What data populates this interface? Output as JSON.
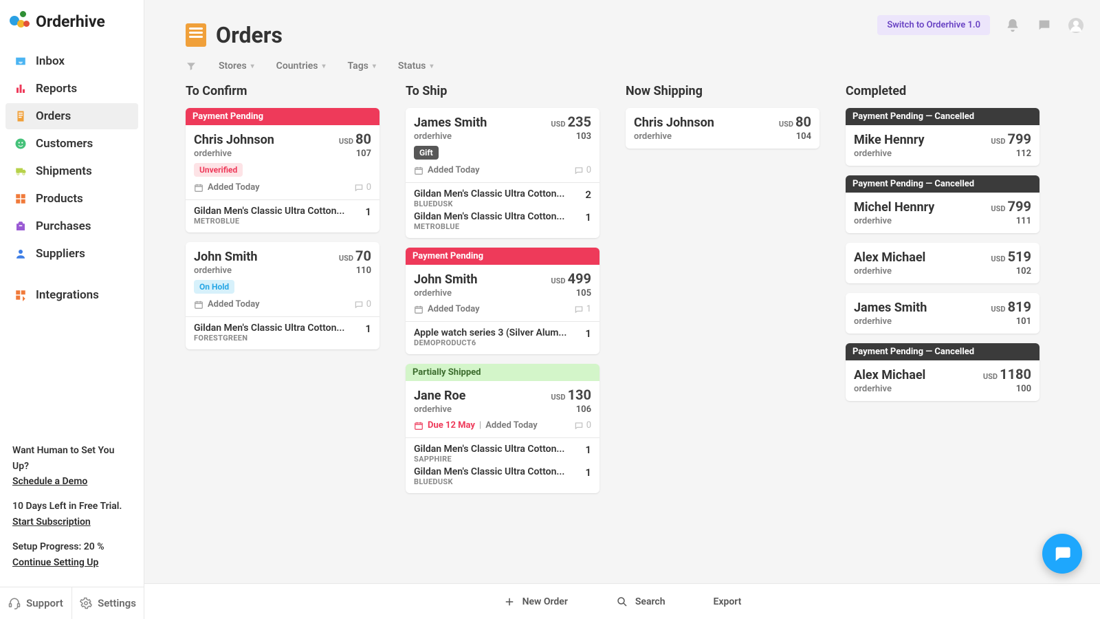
{
  "brand": "Orderhive",
  "topbar": {
    "switch_label": "Switch to Orderhive 1.0"
  },
  "sidebar": {
    "items": [
      {
        "label": "Inbox",
        "icon": "inbox-icon",
        "color": "#4bb4f2"
      },
      {
        "label": "Reports",
        "icon": "reports-icon",
        "color": "#ee3a5a"
      },
      {
        "label": "Orders",
        "icon": "orders-icon",
        "color": "#f0a03a",
        "active": true
      },
      {
        "label": "Customers",
        "icon": "customers-icon",
        "color": "#45c27a"
      },
      {
        "label": "Shipments",
        "icon": "shipments-icon",
        "color": "#b7d24a"
      },
      {
        "label": "Products",
        "icon": "products-icon",
        "color": "#f07a3a"
      },
      {
        "label": "Purchases",
        "icon": "purchases-icon",
        "color": "#9a5ad4"
      },
      {
        "label": "Suppliers",
        "icon": "suppliers-icon",
        "color": "#3d7ee6"
      }
    ],
    "integration_label": "Integrations",
    "promo": {
      "setup_q": "Want Human to Set You Up?",
      "demo_link": "Schedule a Demo",
      "trial_line": "10 Days Left in Free Trial.",
      "sub_link": "Start Subscription",
      "progress_line": "Setup Progress: 20 %",
      "continue_link": "Continue Setting Up"
    },
    "footer": {
      "support": "Support",
      "settings": "Settings"
    }
  },
  "page": {
    "title": "Orders"
  },
  "filters": [
    "Stores",
    "Countries",
    "Tags",
    "Status"
  ],
  "columns": [
    {
      "title": "To Confirm",
      "cards": [
        {
          "banner": "Payment Pending",
          "banner_class": "b-red",
          "customer": "Chris Johnson",
          "currency": "USD",
          "amount": "80",
          "store": "orderhive",
          "order_id": "107",
          "tag": "Unverified",
          "tag_class": "tag-unverified",
          "added": "Added Today",
          "comments": "0",
          "lines": [
            {
              "name": "Gildan Men's Classic Ultra Cotton...",
              "variant": "METROBLUE",
              "qty": "1"
            }
          ]
        },
        {
          "customer": "John Smith",
          "currency": "USD",
          "amount": "70",
          "store": "orderhive",
          "order_id": "110",
          "tag": "On Hold",
          "tag_class": "tag-hold",
          "added": "Added Today",
          "comments": "0",
          "lines": [
            {
              "name": "Gildan Men's Classic Ultra Cotton...",
              "variant": "FORESTGREEN",
              "qty": "1"
            }
          ]
        }
      ]
    },
    {
      "title": "To Ship",
      "cards": [
        {
          "customer": "James Smith",
          "currency": "USD",
          "amount": "235",
          "store": "orderhive",
          "order_id": "103",
          "tag": "Gift",
          "tag_class": "tag-gift",
          "added": "Added Today",
          "comments": "0",
          "lines": [
            {
              "name": "Gildan Men's Classic Ultra Cotton...",
              "variant": "BLUEDUSK",
              "qty": "2"
            },
            {
              "name": "Gildan Men's Classic Ultra Cotton...",
              "variant": "METROBLUE",
              "qty": "1"
            }
          ]
        },
        {
          "banner": "Payment Pending",
          "banner_class": "b-red",
          "customer": "John Smith",
          "currency": "USD",
          "amount": "499",
          "store": "orderhive",
          "order_id": "105",
          "added": "Added Today",
          "comments": "1",
          "lines": [
            {
              "name": "Apple watch series 3 (Silver Alum...",
              "variant": "DEMOPRODUCT6",
              "qty": "1"
            }
          ]
        },
        {
          "banner": "Partially Shipped",
          "banner_class": "b-green",
          "customer": "Jane Roe",
          "currency": "USD",
          "amount": "130",
          "store": "orderhive",
          "order_id": "106",
          "due": "Due 12 May",
          "added": "Added Today",
          "comments": "0",
          "lines": [
            {
              "name": "Gildan Men's Classic Ultra Cotton...",
              "variant": "SAPPHIRE",
              "qty": "1"
            },
            {
              "name": "Gildan Men's Classic Ultra Cotton...",
              "variant": "BLUEDUSK",
              "qty": "1"
            }
          ]
        }
      ]
    },
    {
      "title": "Now Shipping",
      "cards": [
        {
          "customer": "Chris Johnson",
          "currency": "USD",
          "amount": "80",
          "store": "orderhive",
          "order_id": "104",
          "compact": true
        }
      ]
    },
    {
      "title": "Completed",
      "cards": [
        {
          "banner": "Payment Pending — Cancelled",
          "banner_class": "b-dark",
          "customer": "Mike Hennry",
          "currency": "USD",
          "amount": "799",
          "store": "orderhive",
          "order_id": "112",
          "compact": true
        },
        {
          "banner": "Payment Pending — Cancelled",
          "banner_class": "b-dark",
          "customer": "Michel Hennry",
          "currency": "USD",
          "amount": "799",
          "store": "orderhive",
          "order_id": "111",
          "compact": true
        },
        {
          "customer": "Alex Michael",
          "currency": "USD",
          "amount": "519",
          "store": "orderhive",
          "order_id": "102",
          "compact": true
        },
        {
          "customer": "James Smith",
          "currency": "USD",
          "amount": "819",
          "store": "orderhive",
          "order_id": "101",
          "compact": true
        },
        {
          "banner": "Payment Pending — Cancelled",
          "banner_class": "b-dark",
          "customer": "Alex Michael",
          "currency": "USD",
          "amount": "1180",
          "store": "orderhive",
          "order_id": "100",
          "compact": true
        }
      ]
    }
  ],
  "actions": {
    "new": "New Order",
    "search": "Search",
    "export": "Export"
  }
}
